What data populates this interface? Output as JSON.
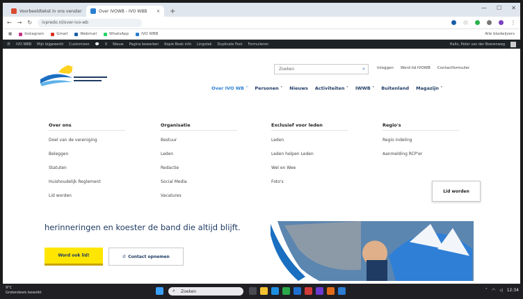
{
  "browser": {
    "tabs": [
      {
        "label": "Voorbeeldtekst in ons venster",
        "active": false,
        "color": "#d84b30"
      },
      {
        "label": "Over IVOWB - IVO WBB",
        "active": true,
        "color": "#2a7fd0"
      }
    ],
    "url": "ivpredo.nl/over-ivo-wb",
    "bookmarks": [
      "Instagram",
      "Gmail",
      "Webmail",
      "WhatsApp",
      "IVO WBB"
    ],
    "bookmarks_right": "Alle bladwijzers"
  },
  "wpbar": {
    "items": [
      "IVO WBB",
      "Mijn bijgewerkt",
      "Customizen",
      "0",
      "Nieuw",
      "Pagina bewerken",
      "Kopie Boek info",
      "Lingotek",
      "Duplicate Post",
      "Formulieren"
    ],
    "right": "Hallo, Peter van der Boerenweg"
  },
  "header": {
    "search_placeholder": "Zoeken",
    "top_links": [
      "Inloggen",
      "Word lid IVOWB",
      "Contactformulier"
    ],
    "nav": [
      {
        "label": "Over IVO WB ˅",
        "active": true
      },
      {
        "label": "Personen ˅",
        "active": false
      },
      {
        "label": "Nieuws",
        "active": false
      },
      {
        "label": "Activiteiten ˅",
        "active": false
      },
      {
        "label": "IWWB ˅",
        "active": false
      },
      {
        "label": "Buitenland",
        "active": false
      },
      {
        "label": "Magazijn ˅",
        "active": false
      }
    ]
  },
  "mega": {
    "columns": [
      {
        "title": "Over ons",
        "items": [
          "Doel van de vereniging",
          "Beleggen",
          "Statuten",
          "Huishoudelijk Reglement",
          "Lid worden"
        ]
      },
      {
        "title": "Organisatie",
        "items": [
          "Bestuur",
          "Leden",
          "Redactie",
          "Social Media",
          "Vacatures"
        ]
      },
      {
        "title": "Exclusief voor leden",
        "items": [
          "Leden",
          "Leden helpen Leden",
          "Wel en Wee",
          "Foto's"
        ]
      },
      {
        "title": "Regio's",
        "items": [
          "Regio indeling",
          "Aanmelding RCP'er"
        ]
      }
    ],
    "cta": "Lid worden"
  },
  "hero": {
    "text": "herinneringen en koester de band die altijd blijft.",
    "primary_button": "Word ook lid!",
    "secondary_button": "Contact opnemen"
  },
  "taskbar": {
    "weather_temp": "9°C",
    "weather_text": "Grotendeels bewolkt",
    "search": "Zoeken",
    "time": "12:34",
    "date": "19-3-2024"
  },
  "colors": {
    "brand_navy": "#1f3b63",
    "accent_yellow": "#ffe600",
    "link_blue": "#2a7fd0"
  }
}
